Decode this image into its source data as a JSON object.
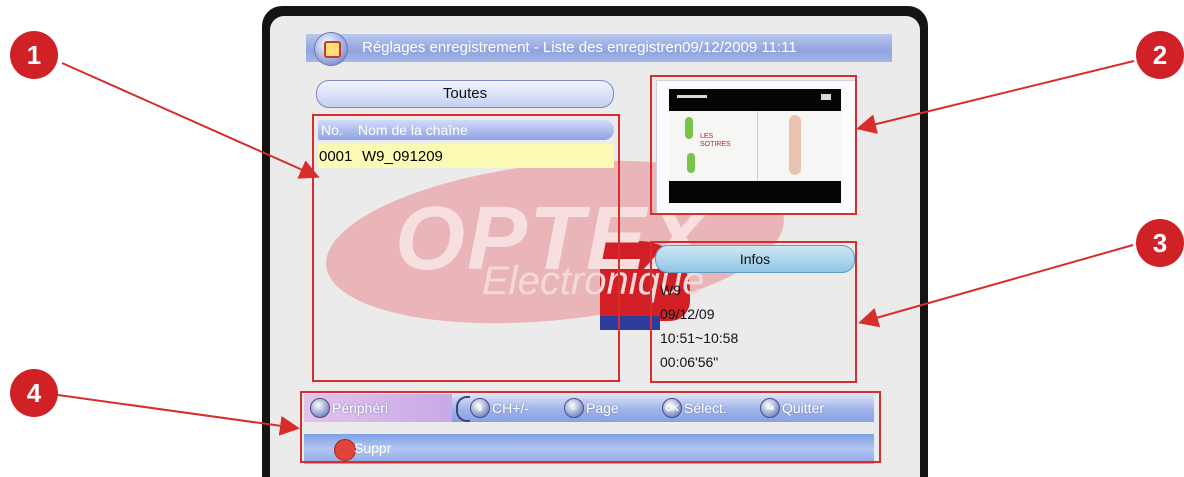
{
  "header": {
    "title": "Réglages enregistrement - Liste des enregistren09/12/2009 11:11"
  },
  "filter": {
    "label": "Toutes"
  },
  "recordings_list": {
    "columns": [
      "No.",
      "Nom de la chaîne"
    ],
    "rows": [
      {
        "no": "0001",
        "name": "W9_091209"
      }
    ]
  },
  "preview": {
    "text": "LES\nSOTIRES"
  },
  "infos": {
    "button_label": "Infos",
    "channel": "W9",
    "date": "09/12/09",
    "time_range": "10:51~10:58",
    "duration": "00:06'56\""
  },
  "footer": {
    "peripheral_label": "Périphéri",
    "channel_label": "CH+/-",
    "page_label": "Page",
    "ok_icon_text": "OK",
    "select_label": "Sélect.",
    "quit_label": "Quitter",
    "delete_label": "Suppr"
  },
  "watermark": {
    "brand": "OPTEX",
    "sub": "Electronique"
  },
  "callouts": [
    "1",
    "2",
    "3",
    "4"
  ],
  "colors": {
    "callout_red": "#d72d2d",
    "highlight_row": "#fafab4",
    "title_bar": "#8fa3de"
  }
}
